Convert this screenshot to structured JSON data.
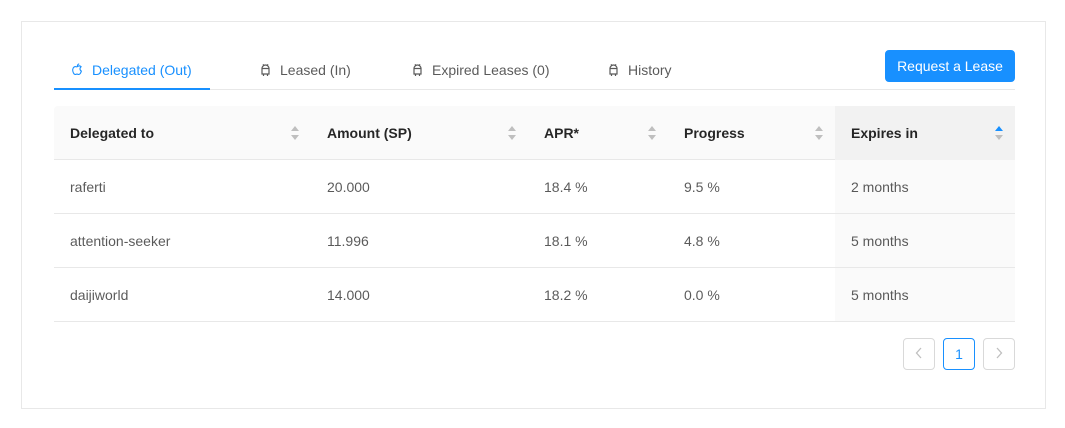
{
  "tabs": [
    {
      "label": "Delegated (Out)",
      "icon": "apple-icon",
      "active": true
    },
    {
      "label": "Leased (In)",
      "icon": "android-icon",
      "active": false
    },
    {
      "label": "Expired Leases (0)",
      "icon": "android-icon",
      "active": false
    },
    {
      "label": "History",
      "icon": "android-icon",
      "active": false
    }
  ],
  "request_button": {
    "label": "Request a Lease"
  },
  "table": {
    "columns": [
      "Delegated to",
      "Amount (SP)",
      "APR*",
      "Progress",
      "Expires in"
    ],
    "sorted_column": "Expires in",
    "rows": [
      {
        "delegated_to": "raferti",
        "amount": "20.000",
        "apr": "18.4 %",
        "progress": "9.5 %",
        "expires": "2 months"
      },
      {
        "delegated_to": "attention-seeker",
        "amount": "11.996",
        "apr": "18.1 %",
        "progress": "4.8 %",
        "expires": "5 months"
      },
      {
        "delegated_to": "daijiworld",
        "amount": "14.000",
        "apr": "18.2 %",
        "progress": "0.0 %",
        "expires": "5 months"
      }
    ]
  },
  "pagination": {
    "current_page": "1",
    "prev_icon": "chevron-left-icon",
    "next_icon": "chevron-right-icon"
  },
  "colors": {
    "accent": "#1890ff",
    "border": "#e8e8e8",
    "header_bg": "#fafafa"
  }
}
